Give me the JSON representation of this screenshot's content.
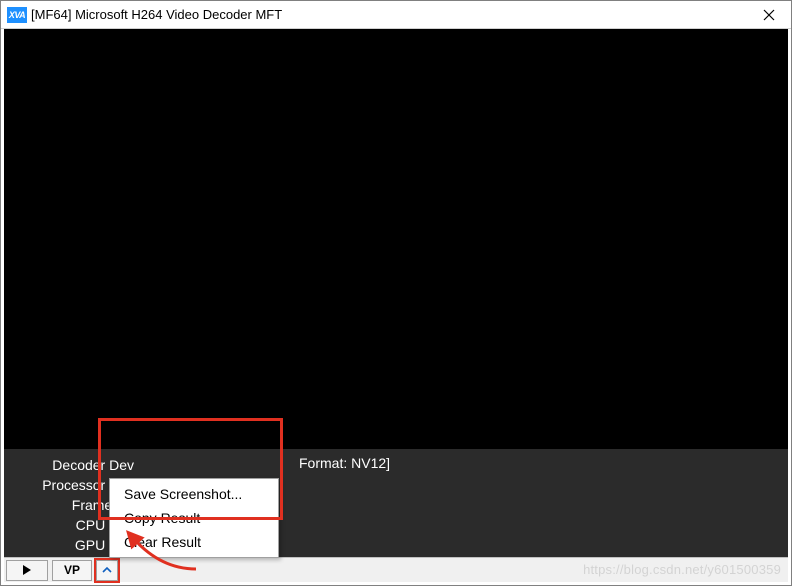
{
  "window": {
    "icon_text": "XVA",
    "title": "[MF64]  Microsoft H264 Video Decoder MFT"
  },
  "info": {
    "rows": [
      {
        "label": "Decoder Dev"
      },
      {
        "label": "Processor Dev"
      },
      {
        "label": "Frame Ra"
      },
      {
        "label": "CPU Usa"
      },
      {
        "label": "GPU Usa"
      }
    ],
    "format_text": "Format: NV12]"
  },
  "context_menu": {
    "items": [
      {
        "label": "Save Screenshot..."
      },
      {
        "label": "Copy Result"
      },
      {
        "label": "Clear Result"
      }
    ]
  },
  "toolbar": {
    "play_icon": "▶",
    "vp_label": "VP",
    "chev_icon": "ˆ"
  },
  "watermark": "https://blog.csdn.net/y601500359",
  "colors": {
    "highlight": "#e03020",
    "info_bg": "#2b2b2b",
    "app_icon": "#1e90ff"
  }
}
